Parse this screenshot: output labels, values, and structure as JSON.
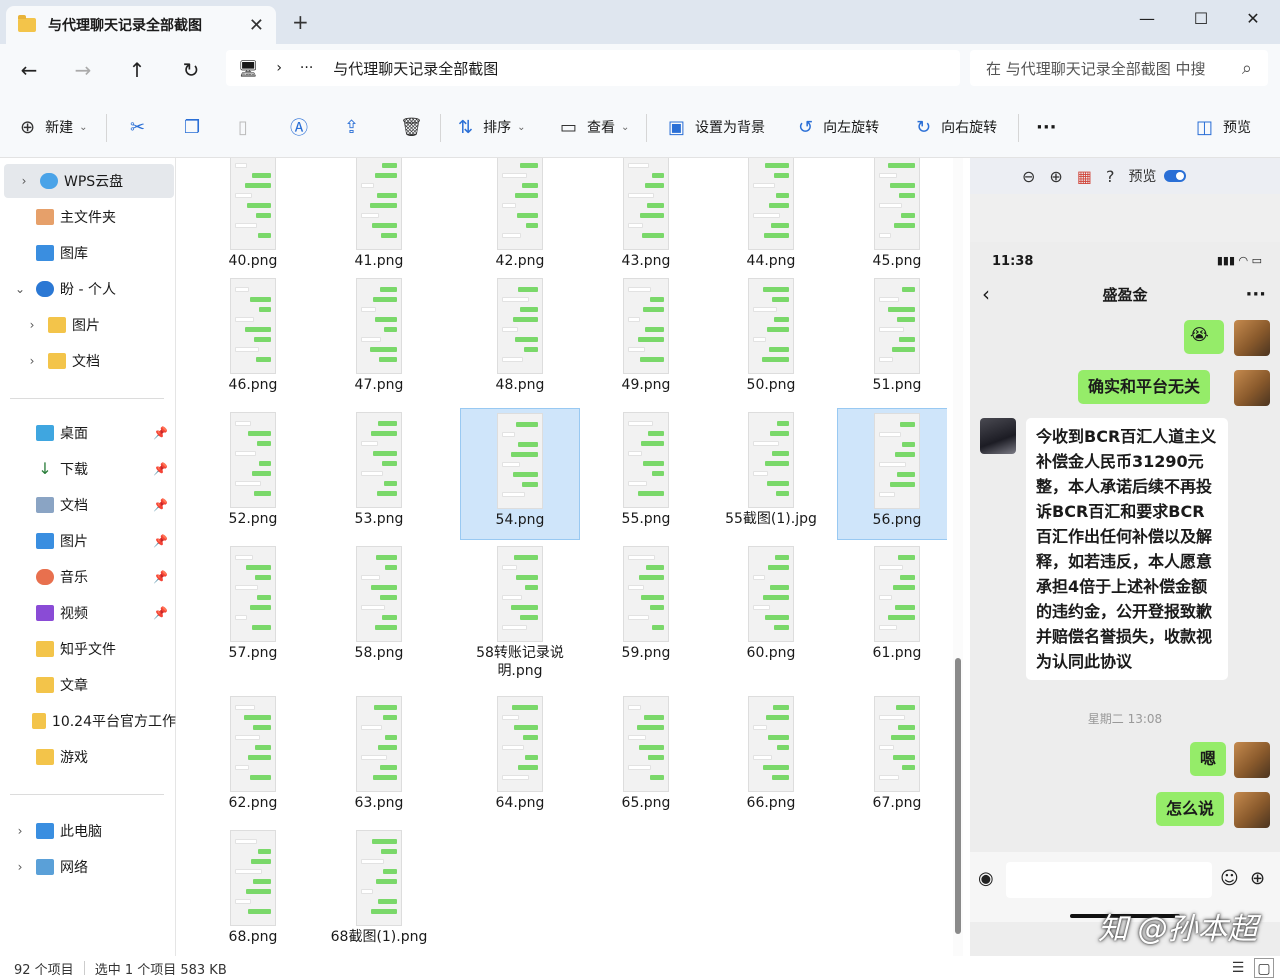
{
  "window": {
    "tab_title": "与代理聊天记录全部截图",
    "tab_close": "✕",
    "new_tab": "+",
    "minimize": "—",
    "maximize": "☐",
    "close": "✕"
  },
  "nav": {
    "back": "←",
    "forward": "→",
    "up": "↑",
    "refresh": "↻",
    "pc_icon": "🖥",
    "chevron": "›",
    "ellipsis": "···",
    "breadcrumb": "与代理聊天记录全部截图",
    "search_placeholder": "在 与代理聊天记录全部截图 中搜",
    "search_icon": "⌕"
  },
  "toolbar": {
    "new_label": "新建",
    "sort_label": "排序",
    "view_label": "查看",
    "set_bg_label": "设置为背景",
    "rotate_left_label": "向左旋转",
    "rotate_right_label": "向右旋转",
    "more_label": "···",
    "preview_label": "预览"
  },
  "sidebar": {
    "items": [
      {
        "label": "WPS云盘"
      },
      {
        "label": "主文件夹"
      },
      {
        "label": "图库"
      },
      {
        "label": "盼 - 个人"
      },
      {
        "label": "图片"
      },
      {
        "label": "文档"
      },
      {
        "label": "桌面"
      },
      {
        "label": "下载"
      },
      {
        "label": "文档"
      },
      {
        "label": "图片"
      },
      {
        "label": "音乐"
      },
      {
        "label": "视频"
      },
      {
        "label": "知乎文件"
      },
      {
        "label": "文章"
      },
      {
        "label": "10.24平台官方工作"
      },
      {
        "label": "游戏"
      },
      {
        "label": "此电脑"
      },
      {
        "label": "网络"
      }
    ]
  },
  "files": {
    "items": [
      {
        "name": "40.png"
      },
      {
        "name": "41.png"
      },
      {
        "name": "42.png"
      },
      {
        "name": "43.png"
      },
      {
        "name": "44.png"
      },
      {
        "name": "45.png"
      },
      {
        "name": "46.png"
      },
      {
        "name": "47.png"
      },
      {
        "name": "48.png"
      },
      {
        "name": "49.png"
      },
      {
        "name": "50.png"
      },
      {
        "name": "51.png"
      },
      {
        "name": "52.png"
      },
      {
        "name": "53.png"
      },
      {
        "name": "54.png"
      },
      {
        "name": "55.png"
      },
      {
        "name": "55截图(1).jpg"
      },
      {
        "name": "56.png"
      },
      {
        "name": "57.png"
      },
      {
        "name": "58.png"
      },
      {
        "name": "58转账记录说明.png"
      },
      {
        "name": "59.png"
      },
      {
        "name": "60.png"
      },
      {
        "name": "61.png"
      },
      {
        "name": "62.png"
      },
      {
        "name": "63.png"
      },
      {
        "name": "64.png"
      },
      {
        "name": "65.png"
      },
      {
        "name": "66.png"
      },
      {
        "name": "67.png"
      },
      {
        "name": "68.png"
      },
      {
        "name": "68截图(1).png"
      }
    ],
    "selected": [
      "54.png",
      "56.png"
    ]
  },
  "preview": {
    "preview_label": "预览",
    "zoom_out_icon": "⊖",
    "zoom_in_icon": "⊕",
    "help_icon": "?",
    "phone_time": "11:38",
    "chat_title": "盛盈金",
    "back_icon": "‹",
    "more_icon": "···",
    "messages": {
      "m1_emoji": "😭",
      "m2": "确实和平台无关",
      "m3": "今收到BCR百汇人道主义补偿金人民币31290元整，本人承诺后续不再投诉BCR百汇和要求BCR百汇作出任何补偿以及解释，如若违反，本人愿意承担4倍于上述补偿金额的违约金，公开登报致歉并赔偿名誉损失，收款视为认同此协议",
      "time": "星期二 13:08",
      "m4": "嗯",
      "m5": "怎么说"
    },
    "watermark": "知 @孙本超"
  },
  "status": {
    "count": "92 个项目",
    "selection": "选中 1 个项目  583 KB"
  }
}
